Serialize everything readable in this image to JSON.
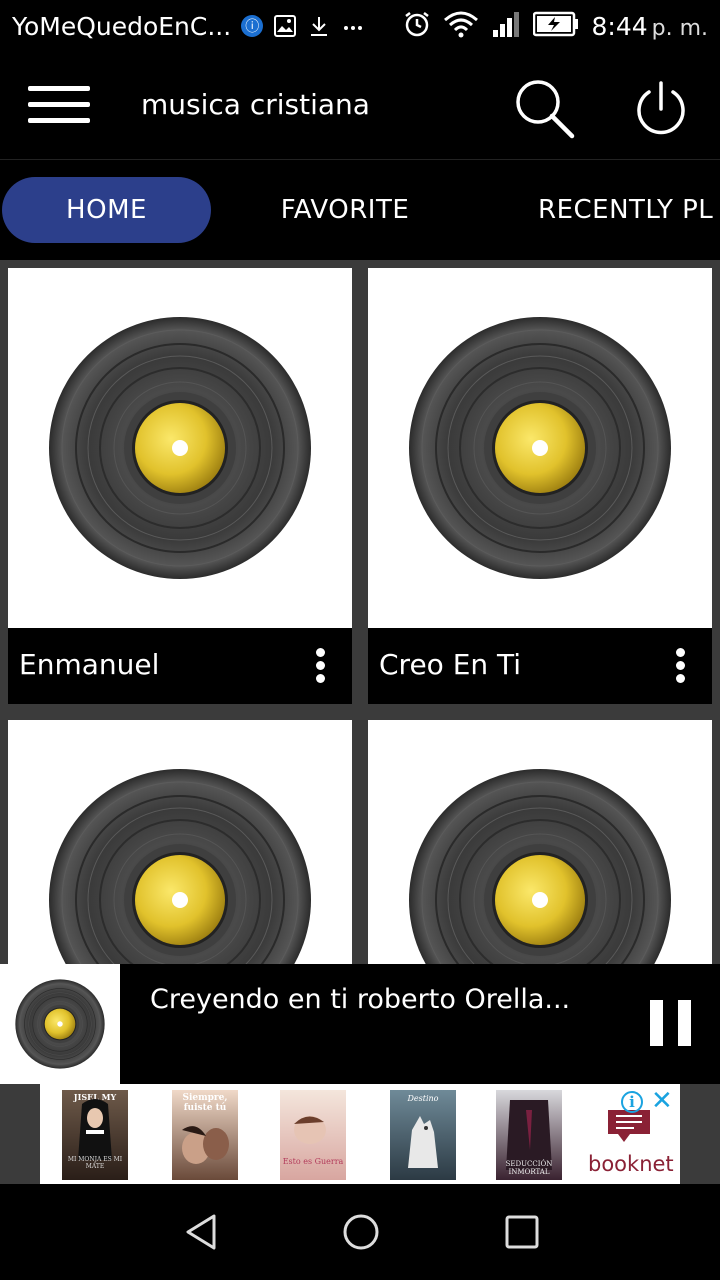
{
  "status_bar": {
    "app_name": "YoMeQuedoEnC...",
    "time": "8:44",
    "ampm": "p. m.",
    "icons": [
      "headset-dot-icon",
      "image-icon",
      "download-icon",
      "more-icon",
      "alarm-icon",
      "wifi-icon",
      "signal-icon",
      "battery-icon"
    ]
  },
  "app_bar": {
    "title": "musica cristiana",
    "icons": [
      "menu-icon",
      "search-icon",
      "power-icon"
    ]
  },
  "tabs": [
    {
      "label": "HOME",
      "active": true
    },
    {
      "label": "FAVORITE",
      "active": false
    },
    {
      "label": "RECENTLY PL",
      "active": false
    }
  ],
  "songs": [
    {
      "title": "Enmanuel"
    },
    {
      "title": "Creo En Ti"
    },
    {
      "title": ""
    },
    {
      "title": ""
    }
  ],
  "player": {
    "title": "Creyendo en ti roberto Orella...",
    "state": "playing"
  },
  "ad": {
    "books": [
      {
        "title": "JISEL MY",
        "subtitle": "MI MONJA ES MI MATE"
      },
      {
        "title": "Siempre, fuiste tú",
        "subtitle": ""
      },
      {
        "title": "Esto es Guerra",
        "subtitle": ""
      },
      {
        "title": "Destino",
        "subtitle": ""
      },
      {
        "title": "SEDUCCIÓN INMORTAL",
        "subtitle": ""
      }
    ],
    "brand": "booknet",
    "info_label": "i",
    "close_label": "✕"
  },
  "colors": {
    "tab_active": "#2c3f8b",
    "grid_bg": "#3b3b3b",
    "vinyl_label": "#e1c22c",
    "brand": "#8a2135",
    "ad_accent": "#1aa3e0"
  }
}
